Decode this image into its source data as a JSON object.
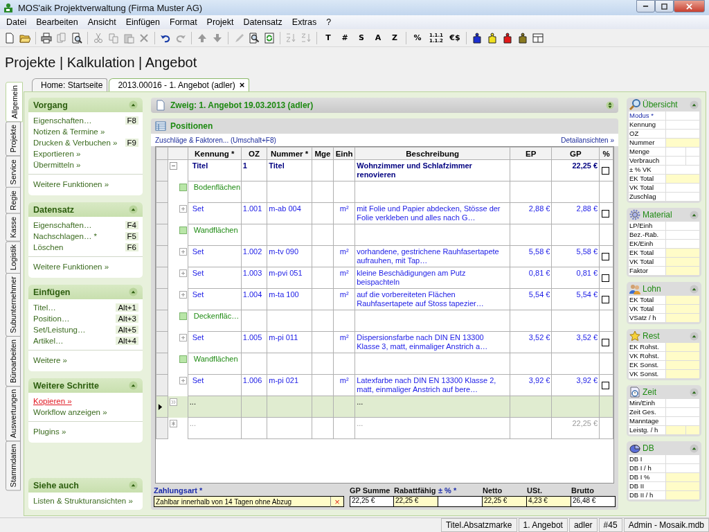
{
  "window": {
    "title": "MOS'aik Projektverwaltung (Firma Muster AG)"
  },
  "menu": [
    "Datei",
    "Bearbeiten",
    "Ansicht",
    "Einfügen",
    "Format",
    "Projekt",
    "Datensatz",
    "Extras",
    "?"
  ],
  "toolbar": {
    "text_groups": [
      [
        "T",
        "#",
        "S",
        "A",
        "Z"
      ],
      [
        "%",
        "1.1.1 1.1.2",
        "€$"
      ]
    ]
  },
  "heading": "Projekte | Kalkulation | Angebot",
  "side_tabs": [
    {
      "label": "Allgemein",
      "selected": true
    },
    {
      "label": "Projekte",
      "selected": false
    },
    {
      "label": "Service",
      "selected": false
    },
    {
      "label": "Regie",
      "selected": false
    },
    {
      "label": "Kasse",
      "selected": false
    },
    {
      "label": "Logistik",
      "selected": false
    },
    {
      "label": "Subunternehmer",
      "selected": false
    },
    {
      "label": "Büroarbeiten",
      "selected": false
    },
    {
      "label": "Auswertungen",
      "selected": false
    },
    {
      "label": "Stammdaten",
      "selected": false
    }
  ],
  "doc_tabs": [
    {
      "label": "Home: Startseite",
      "selected": false
    },
    {
      "label": "2013.00016 - 1. Angebot (adler)",
      "selected": true,
      "close": "×"
    }
  ],
  "tasks": [
    {
      "title": "Vorgang",
      "groups": [
        [
          {
            "label": "Eigenschaften…",
            "shortcut": "F8"
          },
          {
            "label": "Notizen & Termine »"
          },
          {
            "label": "Drucken & Verbuchen »",
            "shortcut": "F9"
          },
          {
            "label": "Exportieren »"
          },
          {
            "label": "Übermitteln »"
          }
        ],
        [
          {
            "label": "Weitere Funktionen »"
          }
        ]
      ]
    },
    {
      "title": "Datensatz",
      "groups": [
        [
          {
            "label": "Eigenschaften…",
            "shortcut": "F4"
          },
          {
            "label": "Nachschlagen… *",
            "shortcut": "F5"
          },
          {
            "label": "Löschen",
            "shortcut": "F6"
          }
        ],
        [
          {
            "label": "Weitere Funktionen »"
          }
        ]
      ]
    },
    {
      "title": "Einfügen",
      "groups": [
        [
          {
            "label": "Titel…",
            "shortcut": "Alt+1"
          },
          {
            "label": "Position…",
            "shortcut": "Alt+3"
          },
          {
            "label": "Set/Leistung…",
            "shortcut": "Alt+5"
          },
          {
            "label": "Artikel…",
            "shortcut": "Alt+4"
          }
        ],
        [
          {
            "label": "Weitere »"
          }
        ]
      ]
    },
    {
      "title": "Weitere Schritte",
      "groups": [
        [
          {
            "label": "Kopieren »",
            "highlight": true
          },
          {
            "label": "Workflow anzeigen »",
            "highlight": false
          }
        ],
        [
          {
            "label": "Plugins »"
          }
        ]
      ]
    },
    {
      "title": "Siehe auch",
      "groups": [
        [
          {
            "label": "Listen & Strukturansichten »"
          }
        ]
      ]
    }
  ],
  "branch": {
    "title": "Zweig: 1. Angebot 19.03.2013 (adler)"
  },
  "positions": {
    "title": "Positionen",
    "link_left": "Zuschläge & Faktoren... (Umschalt+F8)",
    "link_right": "Detailansichten »",
    "columns": [
      "Kennung *",
      "OZ",
      "Nummer *",
      "Mge",
      "Einh",
      "Beschreibung",
      "EP",
      "GP",
      "%"
    ],
    "rows": [
      {
        "kind": "title",
        "selected": false,
        "checked": false,
        "cells": [
          "Titel",
          "1",
          "Titel",
          "",
          "",
          "Wohnzimmer und Schlafzimmer renovieren",
          "",
          "22,25 €"
        ]
      },
      {
        "kind": "group",
        "selected": false,
        "cells": [
          "Bodenflächen",
          "",
          "",
          "",
          "",
          "",
          "",
          ""
        ]
      },
      {
        "kind": "set",
        "selected": false,
        "checked": false,
        "cells": [
          "Set",
          "1.001",
          "m-ab 004",
          "",
          "m²",
          "mit Folie und Papier abdecken, Stösse der Folie verkleben und alles nach G…",
          "2,88 €",
          "2,88 €"
        ]
      },
      {
        "kind": "group",
        "selected": false,
        "cells": [
          "Wandflächen",
          "",
          "",
          "",
          "",
          "",
          "",
          ""
        ]
      },
      {
        "kind": "set",
        "selected": false,
        "checked": false,
        "cells": [
          "Set",
          "1.002",
          "m-tv 090",
          "",
          "m²",
          "vorhandene, gestrichene Rauhfasertapete aufrauhen, mit Tap…",
          "5,58 €",
          "5,58 €"
        ]
      },
      {
        "kind": "set",
        "selected": false,
        "checked": false,
        "cells": [
          "Set",
          "1.003",
          "m-pvi 051",
          "",
          "m²",
          "kleine Beschädigungen am Putz beispachteln",
          "0,81 €",
          "0,81 €"
        ]
      },
      {
        "kind": "set",
        "selected": false,
        "checked": false,
        "cells": [
          "Set",
          "1.004",
          "m-ta 100",
          "",
          "m²",
          "auf die vorbereiteten Flächen Rauhfasertapete auf Stoss tapezier…",
          "5,54 €",
          "5,54 €"
        ]
      },
      {
        "kind": "group",
        "selected": false,
        "cells": [
          "Deckenfläc…",
          "",
          "",
          "",
          "",
          "",
          "",
          ""
        ]
      },
      {
        "kind": "set",
        "selected": false,
        "checked": false,
        "cells": [
          "Set",
          "1.005",
          "m-pi 011",
          "",
          "m²",
          "Dispersionsfarbe nach DIN EN 13300 Klasse 3, matt, einmaliger Anstrich a…",
          "3,52 €",
          "3,52 €"
        ]
      },
      {
        "kind": "group",
        "selected": false,
        "cells": [
          "Wandflächen",
          "",
          "",
          "",
          "",
          "",
          "",
          ""
        ]
      },
      {
        "kind": "set",
        "selected": false,
        "checked": false,
        "cells": [
          "Set",
          "1.006",
          "m-pi 021",
          "",
          "m²",
          "Latexfarbe nach DIN EN 13300 Klasse 2, matt, einmaliger Anstrich auf bere…",
          "3,92 €",
          "3,92 €"
        ]
      },
      {
        "kind": "next",
        "selected": true,
        "cells": [
          "...",
          "",
          "",
          "",
          "",
          "...",
          "",
          ""
        ]
      },
      {
        "kind": "new",
        "selected": false,
        "cells": [
          "...",
          "",
          "",
          "",
          "",
          "...",
          "",
          "22,25 €"
        ]
      }
    ]
  },
  "payment": {
    "label": "Zahlungsart *",
    "value": "Zahlbar innerhalb von 14 Tagen ohne Abzug",
    "clear": "×"
  },
  "totals": [
    {
      "label": "GP Summe",
      "value": "22,25 €",
      "highlight": false,
      "required": false
    },
    {
      "label": "Rabattfähig",
      "value": "22,25 €",
      "highlight": true,
      "required": false
    },
    {
      "label": "± % *",
      "highlight": false,
      "required": true
    },
    {
      "label": "Netto",
      "value": "22,25 €",
      "highlight": true,
      "required": false
    },
    {
      "label": "USt.",
      "value": "4,23 €",
      "highlight": true,
      "required": false
    },
    {
      "label": "Brutto",
      "value": "26,48 €",
      "highlight": false,
      "required": false
    }
  ],
  "details": [
    {
      "kind": "overview",
      "title": "Übersicht",
      "fields": [
        {
          "label": "Modus *",
          "required": true,
          "highlight": false,
          "split": false
        },
        {
          "label": "Kennung",
          "highlight": false,
          "split": false
        },
        {
          "label": "OZ",
          "highlight": false,
          "split": false
        },
        {
          "label": "Nummer",
          "highlight": true,
          "split": false
        },
        {
          "label": "Menge",
          "highlight": false,
          "split": true
        },
        {
          "label": "Verbrauch",
          "highlight": false,
          "split": true
        },
        {
          "label": "± % VK",
          "highlight": false,
          "split": false
        },
        {
          "label": "EK Total",
          "highlight": true,
          "split": false
        },
        {
          "label": "VK Total",
          "highlight": false,
          "split": false
        },
        {
          "label": "Zuschlag",
          "highlight": false,
          "split": false
        }
      ]
    },
    {
      "kind": "material",
      "title": "Material",
      "fields": [
        {
          "label": "LP/Einh",
          "highlight": false,
          "split": false
        },
        {
          "label": "Bez.-Rab.",
          "highlight": false,
          "split": false
        },
        {
          "label": "EK/Einh",
          "highlight": false,
          "split": false
        },
        {
          "label": "EK Total",
          "highlight": true,
          "split": false
        },
        {
          "label": "VK Total",
          "highlight": true,
          "split": false
        },
        {
          "label": "Faktor",
          "highlight": true,
          "split": false
        }
      ]
    },
    {
      "kind": "labor",
      "title": "Lohn",
      "fields": [
        {
          "label": "EK Total",
          "highlight": true,
          "split": false
        },
        {
          "label": "VK Total",
          "highlight": true,
          "split": false
        },
        {
          "label": "VSatz / h",
          "highlight": true,
          "split": false
        }
      ]
    },
    {
      "kind": "rest",
      "title": "Rest",
      "fields": [
        {
          "label": "EK Rohst.",
          "highlight": true,
          "split": false
        },
        {
          "label": "VK Rohst.",
          "highlight": true,
          "split": false
        },
        {
          "label": "EK Sonst.",
          "highlight": true,
          "split": false
        },
        {
          "label": "VK Sonst.",
          "highlight": true,
          "split": false
        }
      ]
    },
    {
      "kind": "time",
      "title": "Zeit",
      "fields": [
        {
          "label": "Min/Einh",
          "highlight": false,
          "split": false
        },
        {
          "label": "Zeit Ges.",
          "highlight": false,
          "split": false
        },
        {
          "label": "Manntage",
          "highlight": false,
          "split": false
        },
        {
          "label": "Leistg. / h",
          "highlight": true,
          "split": true
        }
      ]
    },
    {
      "kind": "margin",
      "title": "DB",
      "fields": [
        {
          "label": "DB I",
          "highlight": false,
          "split": false
        },
        {
          "label": "DB I / h",
          "highlight": false,
          "split": false
        },
        {
          "label": "DB I %",
          "highlight": true,
          "split": false
        },
        {
          "label": "DB II",
          "highlight": true,
          "split": false
        },
        {
          "label": "DB II / h",
          "highlight": true,
          "split": false
        }
      ]
    }
  ],
  "status_bar": [
    "Titel.Absatzmarke",
    "1. Angebot",
    "adler",
    "#45",
    "Admin - Mosaik.mdb"
  ]
}
